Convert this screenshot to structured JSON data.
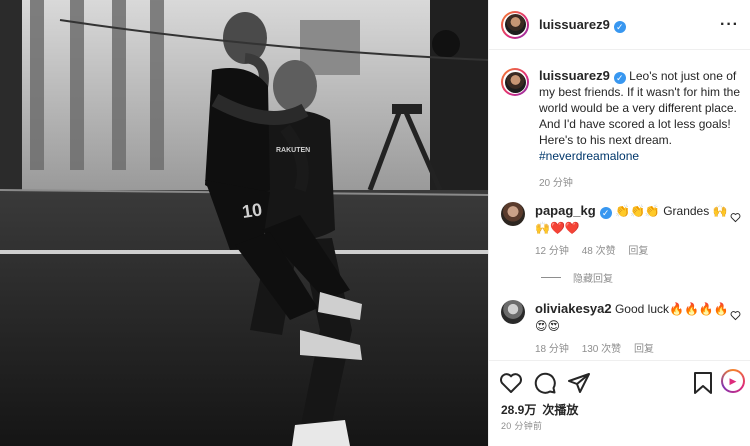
{
  "post": {
    "author": "luissuarez9",
    "caption": "Leo's not just one of my best friends. If it wasn't for him the world would be a very different place. And I'd have scored a lot less goals! Here's to his next dream.",
    "hashtag": "#neverdreamalone",
    "caption_time": "20 分钟",
    "likes_count": "28.9万",
    "likes_label": "次播放",
    "posted_time": "20 分钟前"
  },
  "photo": {
    "kit_number": "10",
    "kit_sponsor": "RAKUTEN"
  },
  "comments": [
    {
      "user": "papag_kg",
      "text": "👏👏👏 Grandes 🙌🙌❤️❤️",
      "time": "12 分钟",
      "likes": "48 次赞",
      "reply": "回复",
      "hidden_replies": "隐藏回复"
    },
    {
      "user": "oliviakesya2",
      "text": "Good luck🔥🔥🔥🔥😍😍",
      "time": "18 分钟",
      "likes": "130 次赞",
      "reply": "回复"
    }
  ],
  "icons": {
    "more": "more-options-icon",
    "verified": "verified-badge-icon",
    "like": "heart-icon",
    "comment": "comment-icon",
    "share": "share-icon",
    "save": "bookmark-icon",
    "reel": "reel-icon"
  },
  "colors": {
    "verified": "#3897f0",
    "hashtag": "#00376b",
    "meta": "#8e8e8e",
    "text": "#262626"
  }
}
